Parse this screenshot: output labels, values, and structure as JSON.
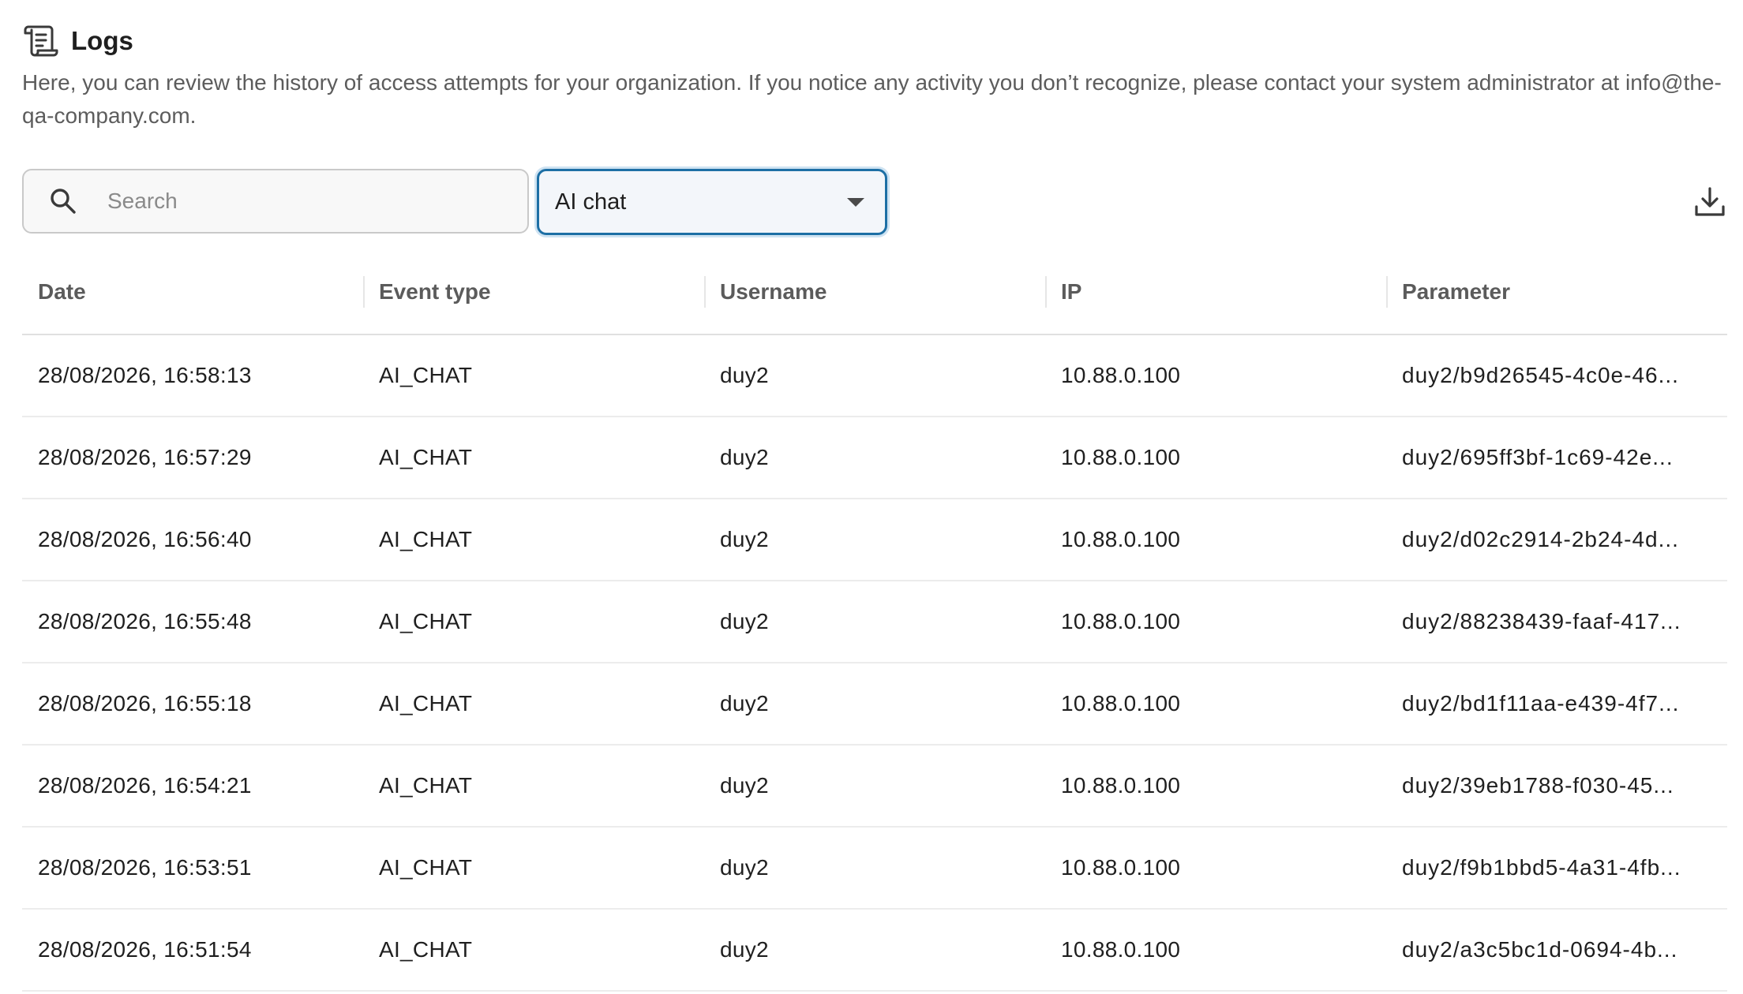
{
  "header": {
    "title": "Logs",
    "description": "Here, you can review the history of access attempts for your organization. If you notice any activity you don’t recognize, please contact your system administrator at info@the-qa-company.com."
  },
  "toolbar": {
    "search_placeholder": "Search",
    "search_value": "",
    "filter_selected": "AI chat"
  },
  "table": {
    "columns": [
      "Date",
      "Event type",
      "Username",
      "IP",
      "Parameter"
    ],
    "rows": [
      [
        "28/08/2026, 16:58:13",
        "AI_CHAT",
        "duy2",
        "10.88.0.100",
        "duy2/b9d26545-4c0e-46..."
      ],
      [
        "28/08/2026, 16:57:29",
        "AI_CHAT",
        "duy2",
        "10.88.0.100",
        "duy2/695ff3bf-1c69-42e..."
      ],
      [
        "28/08/2026, 16:56:40",
        "AI_CHAT",
        "duy2",
        "10.88.0.100",
        "duy2/d02c2914-2b24-4d..."
      ],
      [
        "28/08/2026, 16:55:48",
        "AI_CHAT",
        "duy2",
        "10.88.0.100",
        "duy2/88238439-faaf-417..."
      ],
      [
        "28/08/2026, 16:55:18",
        "AI_CHAT",
        "duy2",
        "10.88.0.100",
        "duy2/bd1f11aa-e439-4f7..."
      ],
      [
        "28/08/2026, 16:54:21",
        "AI_CHAT",
        "duy2",
        "10.88.0.100",
        "duy2/39eb1788-f030-45..."
      ],
      [
        "28/08/2026, 16:53:51",
        "AI_CHAT",
        "duy2",
        "10.88.0.100",
        "duy2/f9b1bbd5-4a31-4fb..."
      ],
      [
        "28/08/2026, 16:51:54",
        "AI_CHAT",
        "duy2",
        "10.88.0.100",
        "duy2/a3c5bc1d-0694-4b..."
      ]
    ]
  },
  "icons": {
    "header": "scroll-icon",
    "search": "search-icon",
    "filter": "caret-down-icon",
    "export": "download-icon"
  },
  "colors": {
    "accent": "#1d6fa5",
    "text": "#1f1f1f",
    "muted": "#5c5c5c"
  }
}
